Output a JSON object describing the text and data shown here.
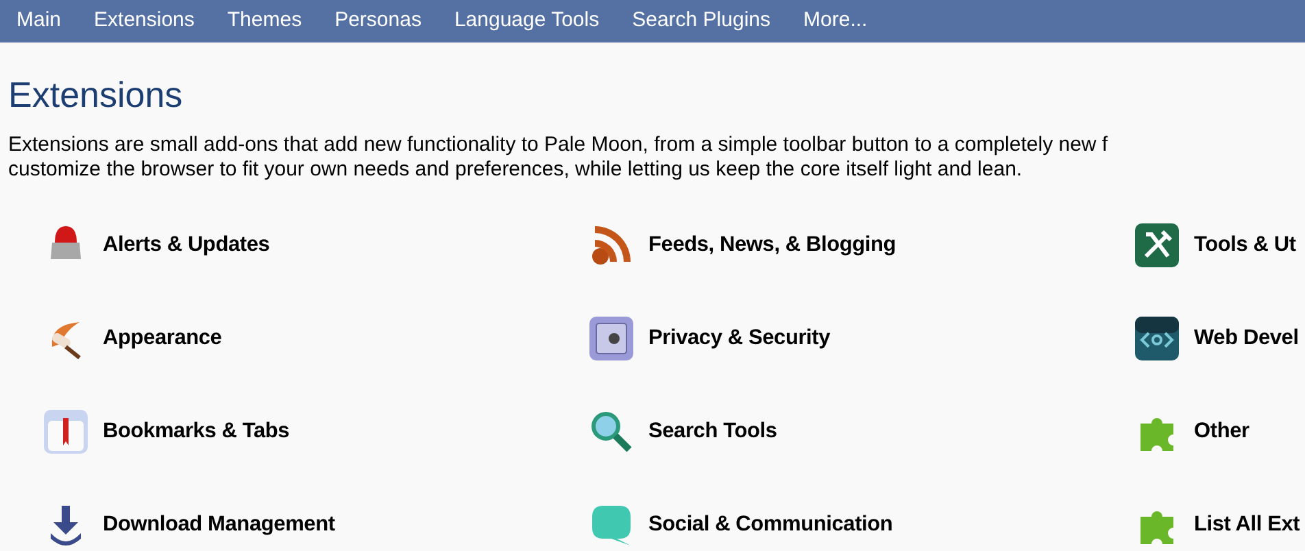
{
  "nav": {
    "items": [
      {
        "label": "Main",
        "selected": false
      },
      {
        "label": "Extensions",
        "selected": false
      },
      {
        "label": "Themes",
        "selected": false
      },
      {
        "label": "Personas",
        "selected": false
      },
      {
        "label": "Language Tools",
        "selected": false
      },
      {
        "label": "Search Plugins",
        "selected": false
      },
      {
        "label": "More...",
        "selected": false
      }
    ]
  },
  "heading": "Extensions",
  "intro_lines": [
    "Extensions are small add-ons that add new functionality to Pale Moon, from a simple toolbar button to a completely new f",
    "customize the browser to fit your own needs and preferences, while letting us keep the core itself light and lean."
  ],
  "categories": [
    {
      "label": "Alerts & Updates",
      "kind": "alert"
    },
    {
      "label": "Feeds, News, & Blogging",
      "kind": "feed"
    },
    {
      "label": "Tools & Ut",
      "kind": "tools"
    },
    {
      "label": "Appearance",
      "kind": "paint"
    },
    {
      "label": "Privacy & Security",
      "kind": "safe"
    },
    {
      "label": "Web Devel",
      "kind": "code"
    },
    {
      "label": "Bookmarks & Tabs",
      "kind": "bookmark"
    },
    {
      "label": "Search Tools",
      "kind": "search"
    },
    {
      "label": "Other",
      "kind": "puzzle"
    },
    {
      "label": "Download Management",
      "kind": "download"
    },
    {
      "label": "Social & Communication",
      "kind": "chat"
    },
    {
      "label": "List All Ext",
      "kind": "puzzle"
    }
  ]
}
